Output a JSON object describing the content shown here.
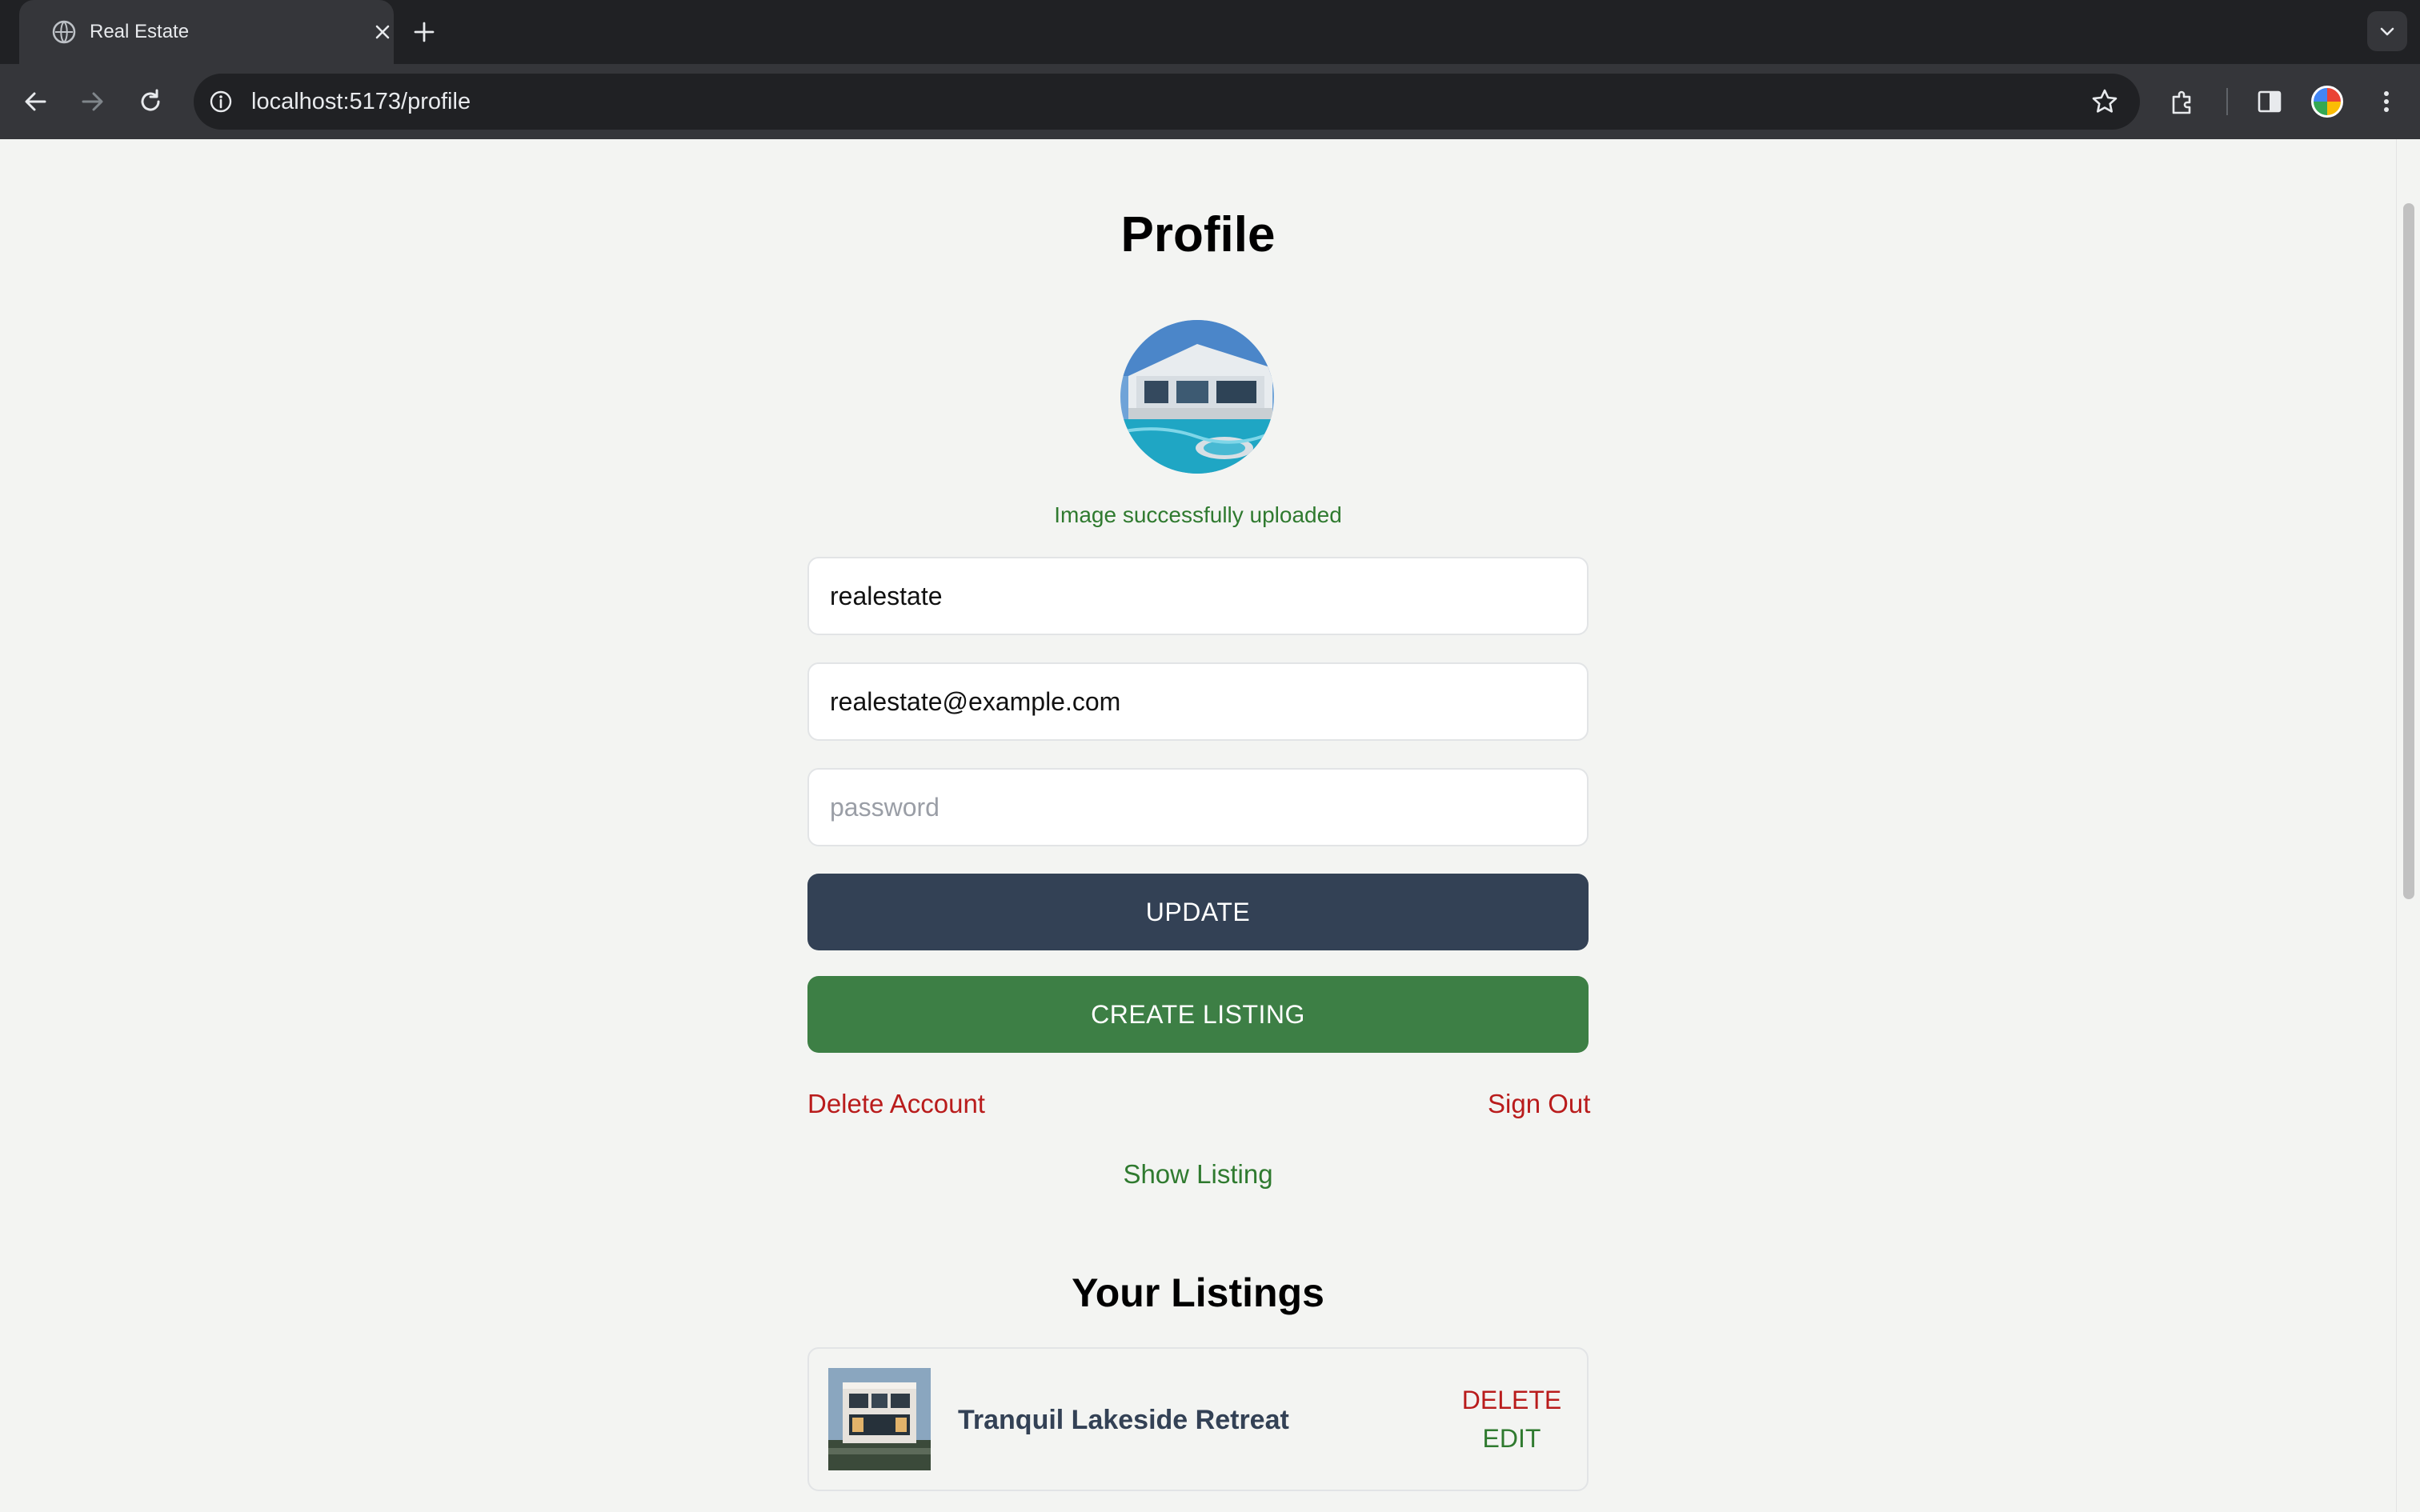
{
  "browser": {
    "tab_title": "Real Estate",
    "url": "localhost:5173/profile"
  },
  "page": {
    "title": "Profile",
    "upload_message": "Image successfully uploaded",
    "form": {
      "username_value": "realestate",
      "email_value": "realestate@example.com",
      "password_placeholder": "password",
      "update_label": "UPDATE",
      "create_listing_label": "CREATE LISTING"
    },
    "links": {
      "delete_account": "Delete Account",
      "sign_out": "Sign Out",
      "show_listing": "Show Listing"
    },
    "listings_title": "Your Listings",
    "listings": [
      {
        "name": "Tranquil Lakeside Retreat",
        "delete_label": "DELETE",
        "edit_label": "EDIT"
      }
    ]
  },
  "colors": {
    "update_button": "#334155",
    "create_button": "#3d7f45",
    "danger": "#b91c1c",
    "success": "#2f7a2f"
  }
}
